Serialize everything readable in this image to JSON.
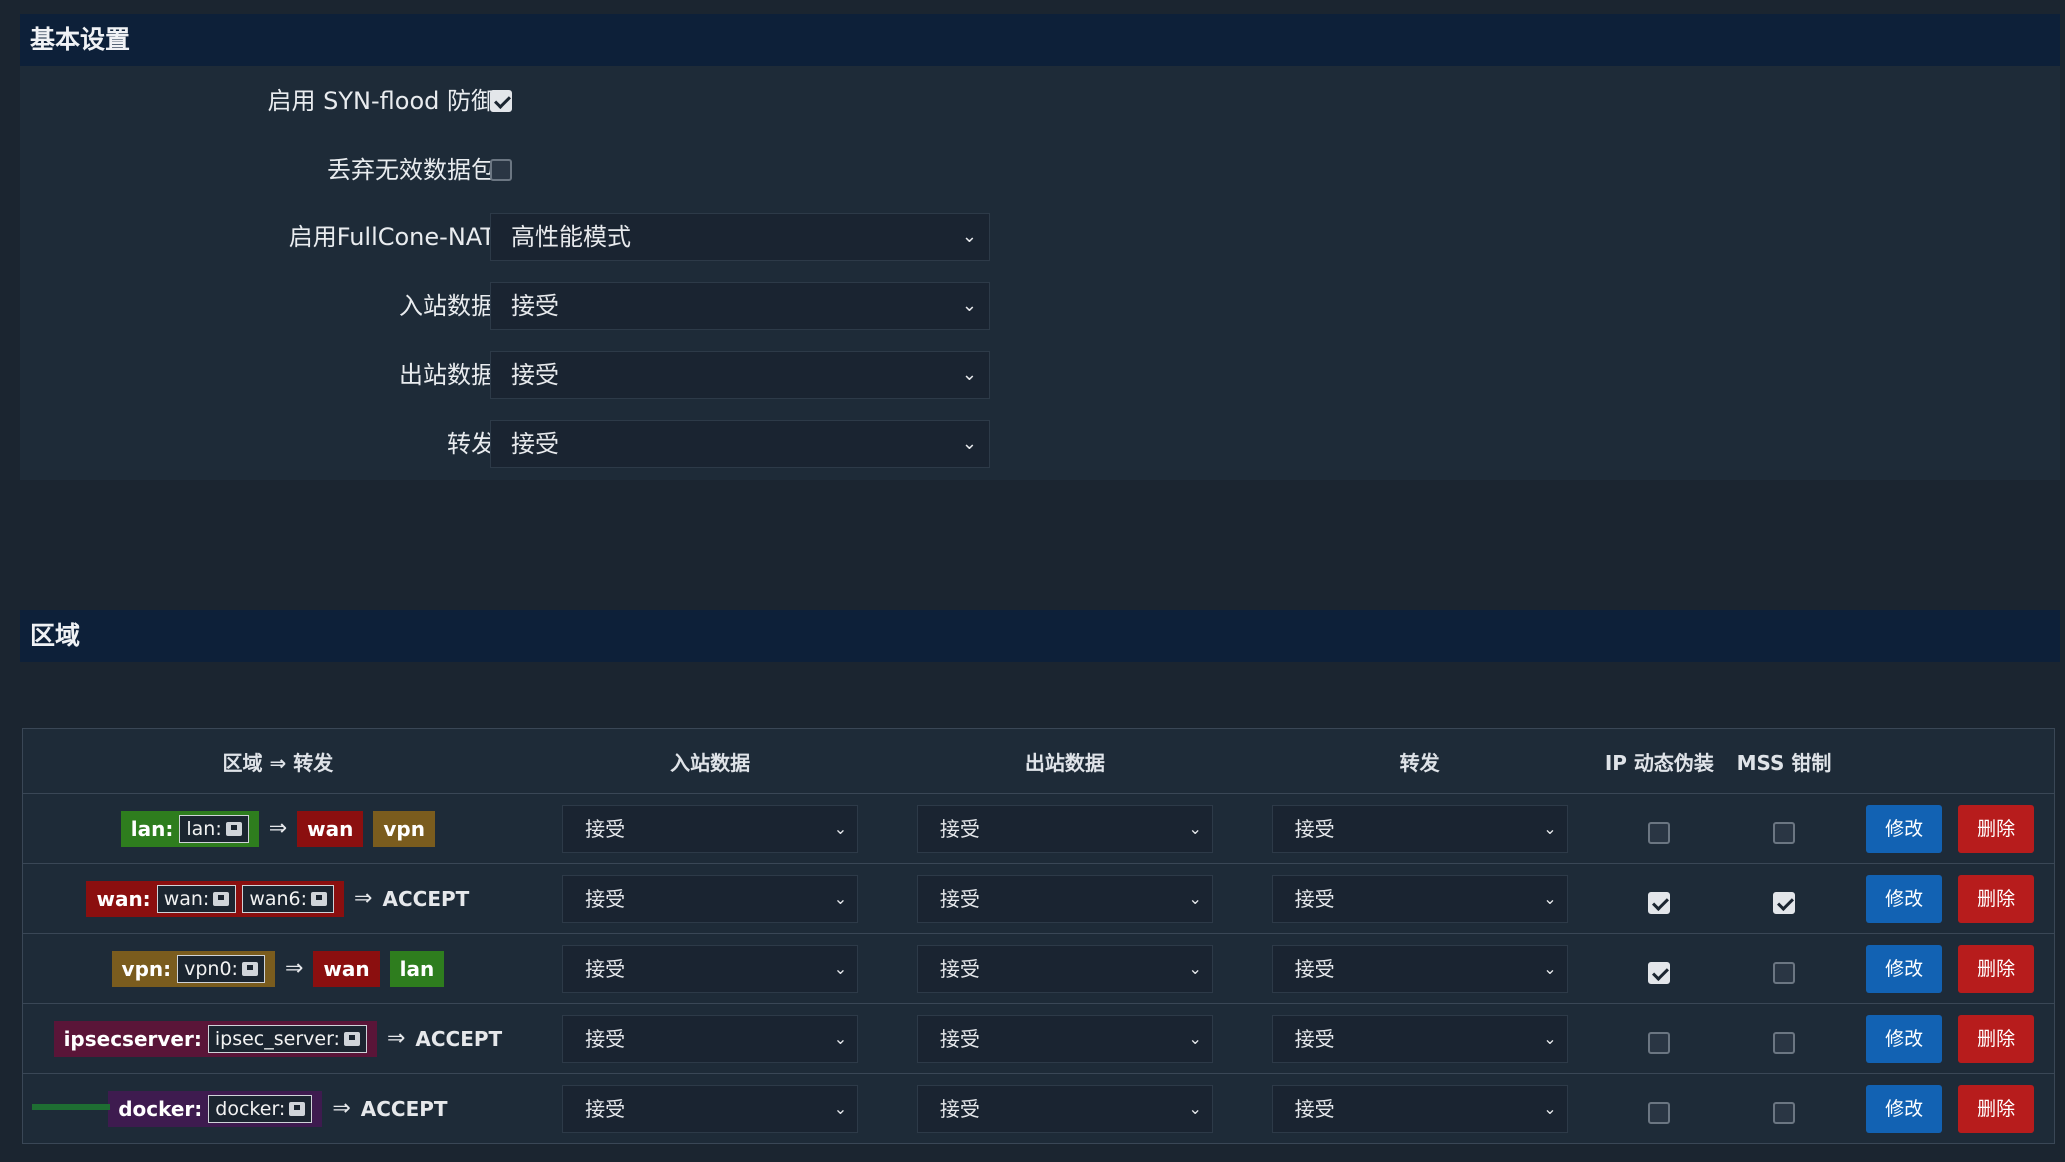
{
  "basic": {
    "title": "基本设置",
    "syn_label": "启用 SYN-flood 防御",
    "syn_checked": true,
    "drop_label": "丢弃无效数据包",
    "drop_checked": false,
    "fullcone_label": "启用FullCone-NAT",
    "fullcone_value": "高性能模式",
    "input_label": "入站数据",
    "input_value": "接受",
    "output_label": "出站数据",
    "output_value": "接受",
    "forward_label": "转发",
    "forward_value": "接受"
  },
  "zones": {
    "title": "区域",
    "headers": {
      "zone": "区域 ⇒ 转发",
      "input": "入站数据",
      "output": "出站数据",
      "forward": "转发",
      "masq": "IP 动态伪装",
      "mss": "MSS 钳制"
    },
    "edit_label": "修改",
    "delete_label": "删除",
    "arrow": "⇒",
    "rows": [
      {
        "zone": "lan:",
        "color": "#2e7d1e",
        "iface": [
          "lan:"
        ],
        "targets": [
          {
            "name": "wan",
            "color": "#8b0f0f"
          },
          {
            "name": "vpn",
            "color": "#7a5c1e"
          }
        ],
        "policy": "",
        "input": "接受",
        "output": "接受",
        "forward": "接受",
        "masq": false,
        "mss": false
      },
      {
        "zone": "wan:",
        "color": "#8b0f0f",
        "iface": [
          "wan:",
          "wan6:"
        ],
        "targets": [],
        "policy": "ACCEPT",
        "input": "接受",
        "output": "接受",
        "forward": "接受",
        "masq": true,
        "mss": true
      },
      {
        "zone": "vpn:",
        "color": "#7a5c1e",
        "iface": [
          "vpn0:"
        ],
        "targets": [
          {
            "name": "wan",
            "color": "#8b0f0f"
          },
          {
            "name": "lan",
            "color": "#2e7d1e"
          }
        ],
        "policy": "",
        "input": "接受",
        "output": "接受",
        "forward": "接受",
        "masq": true,
        "mss": false
      },
      {
        "zone": "ipsecserver:",
        "color": "#5a1538",
        "iface": [
          "ipsec_server:"
        ],
        "targets": [],
        "policy": "ACCEPT",
        "input": "接受",
        "output": "接受",
        "forward": "接受",
        "masq": false,
        "mss": false
      },
      {
        "zone": "docker:",
        "color": "#3e1b4f",
        "iface": [
          "docker:"
        ],
        "targets": [],
        "policy": "ACCEPT",
        "input": "接受",
        "output": "接受",
        "forward": "接受",
        "masq": false,
        "mss": false
      }
    ]
  },
  "icons": {
    "checkbox": "checkbox-icon",
    "chevron": "chevron-down-icon",
    "network": "network-port-icon"
  },
  "colors": {
    "header_bg": "#0d2039",
    "panel_bg": "#1e2b38",
    "edit": "#1262b3",
    "delete": "#b71c1c"
  }
}
